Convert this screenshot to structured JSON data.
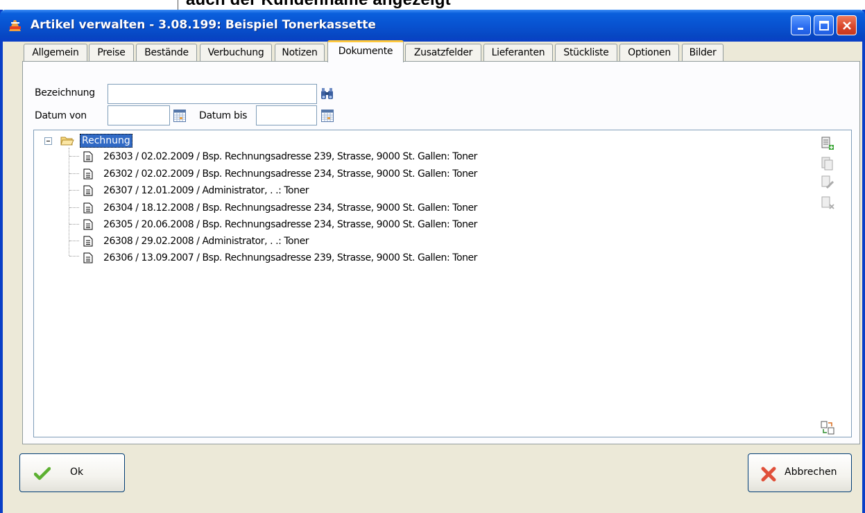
{
  "background": {
    "caption": "auch der Kundenname angezeigt"
  },
  "window": {
    "title": "Artikel verwalten - 3.08.199: Beispiel Tonerkassette",
    "colors": {
      "titlebar": "#0852d0",
      "active_tab_accent": "#ffc83c",
      "selection": "#316ac5"
    }
  },
  "tabs": [
    {
      "label": "Allgemein",
      "active": false
    },
    {
      "label": "Preise",
      "active": false
    },
    {
      "label": "Bestände",
      "active": false
    },
    {
      "label": "Verbuchung",
      "active": false
    },
    {
      "label": "Notizen",
      "active": false
    },
    {
      "label": "Dokumente",
      "active": true
    },
    {
      "label": "Zusatzfelder",
      "active": false
    },
    {
      "label": "Lieferanten",
      "active": false
    },
    {
      "label": "Stückliste",
      "active": false
    },
    {
      "label": "Optionen",
      "active": false
    },
    {
      "label": "Bilder",
      "active": false
    }
  ],
  "filters": {
    "bezeichnung_label": "Bezeichnung",
    "bezeichnung_value": "",
    "datum_von_label": "Datum von",
    "datum_von_value": "",
    "datum_bis_label": "Datum bis",
    "datum_bis_value": ""
  },
  "tree": {
    "root": "Rechnung",
    "items": [
      "26303  /  02.02.2009 / Bsp. Rechnungsadresse 239, Strasse, 9000 St. Gallen: Toner",
      "26302  /  02.02.2009 / Bsp. Rechnungsadresse 234, Strasse, 9000 St. Gallen: Toner",
      "26307  /  12.01.2009 / Administrator, . .: Toner",
      "26304  /  18.12.2008 / Bsp. Rechnungsadresse 234, Strasse, 9000 St. Gallen: Toner",
      "26305  /  20.06.2008 / Bsp. Rechnungsadresse 234, Strasse, 9000 St. Gallen: Toner",
      "26308  /  29.02.2008 / Administrator, . .: Toner",
      "26306  /  13.09.2007 / Bsp. Rechnungsadresse 239, Strasse, 9000 St. Gallen: Toner"
    ]
  },
  "side_icons": [
    "add-document-icon",
    "copy-document-icon",
    "edit-document-icon",
    "delete-document-icon",
    "transfer-icon"
  ],
  "buttons": {
    "ok": "Ok",
    "cancel": "Abbrechen"
  }
}
